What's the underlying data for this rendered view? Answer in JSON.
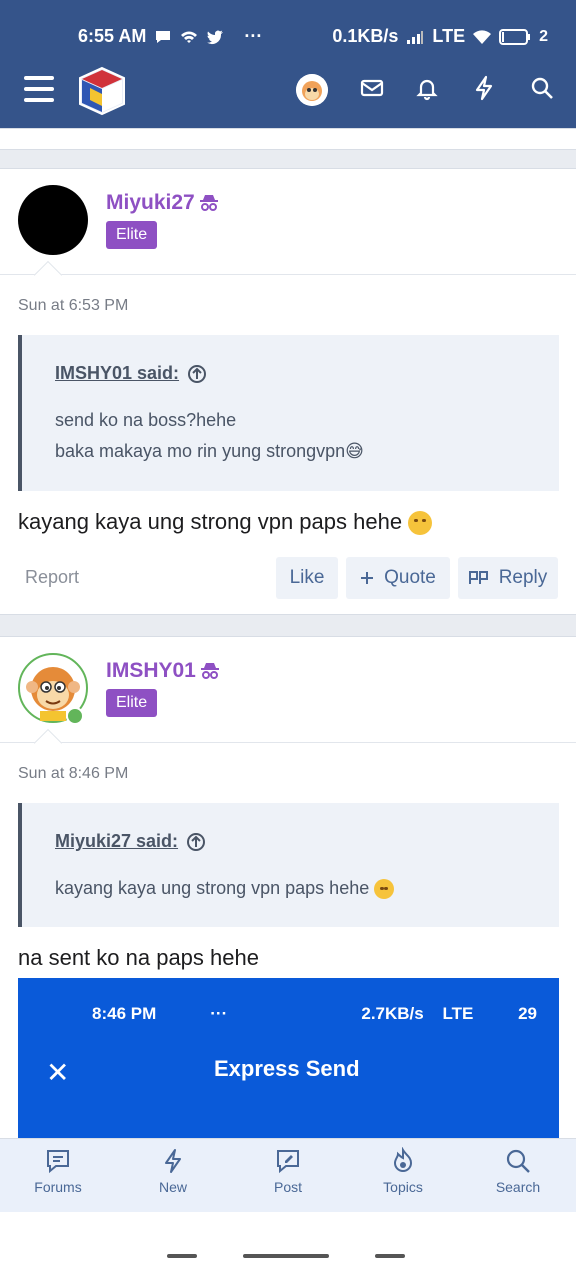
{
  "status_bar": {
    "time": "6:55 AM",
    "dots": "···",
    "net_speed": "0.1KB/s",
    "network": "LTE",
    "battery": "2"
  },
  "header": {
    "icons": [
      "menu-icon",
      "site-logo",
      "user-avatar",
      "inbox-icon",
      "bell-icon",
      "bolt-icon",
      "search-icon"
    ]
  },
  "posts": [
    {
      "username": "Miyuki27",
      "rank": "Elite",
      "timestamp": "Sun at 6:53 PM",
      "quote_author": "IMSHY01 said:",
      "quote_lines": [
        "send ko na boss?hehe",
        "baka makaya mo rin yung strongvpn😅"
      ],
      "message": "kayang kaya ung strong vpn paps hehe",
      "actions": {
        "report": "Report",
        "like": "Like",
        "quote": "Quote",
        "reply": "Reply"
      }
    },
    {
      "username": "IMSHY01",
      "rank": "Elite",
      "timestamp": "Sun at 8:46 PM",
      "quote_author": "Miyuki27 said:",
      "quote_lines": [
        "kayang kaya ung strong vpn paps hehe"
      ],
      "message": "na sent ko na paps hehe",
      "attachment": {
        "time": "8:46 PM",
        "dots": "···",
        "net": "2.7KB/s",
        "network": "LTE",
        "battery": "29",
        "close": "✕",
        "title": "Express Send"
      }
    }
  ],
  "tabs": [
    "Forums",
    "New",
    "Post",
    "Topics",
    "Search"
  ]
}
